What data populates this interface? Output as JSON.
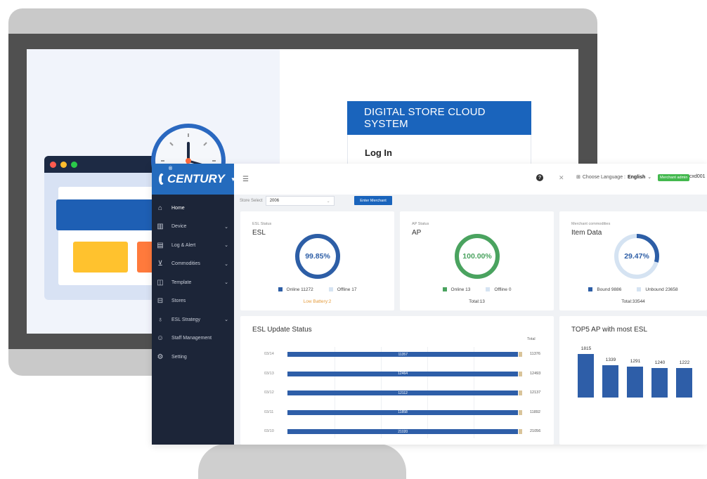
{
  "login": {
    "system_title": "DIGITAL STORE CLOUD SYSTEM",
    "login_title": "Log In"
  },
  "brand": {
    "name": "CENTURY",
    "reg": "®"
  },
  "sidebar": {
    "items": [
      {
        "label": "Home",
        "icon": "home-icon",
        "active": true,
        "chevron": false
      },
      {
        "label": "Device",
        "icon": "device-icon",
        "chevron": true
      },
      {
        "label": "Log & Alert",
        "icon": "log-icon",
        "chevron": true
      },
      {
        "label": "Commodities",
        "icon": "cart-icon",
        "chevron": true
      },
      {
        "label": "Template",
        "icon": "template-icon",
        "chevron": true
      },
      {
        "label": "Stores",
        "icon": "store-icon",
        "chevron": false
      },
      {
        "label": "ESL Strategy",
        "icon": "bulb-icon",
        "chevron": true
      },
      {
        "label": "Staff Management",
        "icon": "user-icon",
        "chevron": false
      },
      {
        "label": "Setting",
        "icon": "gear-icon",
        "chevron": false
      }
    ]
  },
  "topbar": {
    "language_label": "Choose Language :",
    "language_value": "English",
    "role_badge": "Merchant admin",
    "username": "cxd001"
  },
  "store": {
    "label": "Store Select",
    "value": "2006",
    "enter_button": "Enter Merchant"
  },
  "cards": {
    "esl": {
      "small": "ESL Status",
      "big": "ESL",
      "percent": "99.85%",
      "fraction": 0.9985,
      "color": "#2d5ea6",
      "track": "#e3e7ee",
      "online_label": "Online",
      "online": "11272",
      "offline_label": "Offline",
      "offline": "17",
      "footnote": "Low Battery:2"
    },
    "ap": {
      "small": "AP Status",
      "big": "AP",
      "percent": "100.00%",
      "fraction": 1.0,
      "color": "#4aa35f",
      "track": "#e3e7ee",
      "online_label": "Online",
      "online": "13",
      "offline_label": "Offline",
      "offline": "0",
      "footnote": "Total:13"
    },
    "items": {
      "small": "Merchant commodities",
      "big": "Item Data",
      "percent": "29.47%",
      "fraction": 0.2947,
      "color": "#2d5ea6",
      "track": "#d5e3f2",
      "online_label": "Bound",
      "online": "9886",
      "offline_label": "Unbound",
      "offline": "23658",
      "footnote": "Total:33544"
    }
  },
  "update": {
    "title": "ESL Update Status",
    "total_label": "Total",
    "rows": [
      {
        "date": "03/14",
        "value": "11357",
        "total": "11376"
      },
      {
        "date": "03/13",
        "value": "12464",
        "total": "12493"
      },
      {
        "date": "03/12",
        "value": "12112",
        "total": "12137"
      },
      {
        "date": "03/11",
        "value": "11858",
        "total": "11892"
      },
      {
        "date": "03/10",
        "value": "21020",
        "total": "21056"
      }
    ]
  },
  "chart_data": {
    "type": "bar",
    "title": "TOP5 AP with most ESL",
    "values": [
      1815,
      1339,
      1291,
      1240,
      1222
    ],
    "labels": [
      "1815",
      "1339",
      "1291",
      "1240",
      "1222"
    ]
  }
}
